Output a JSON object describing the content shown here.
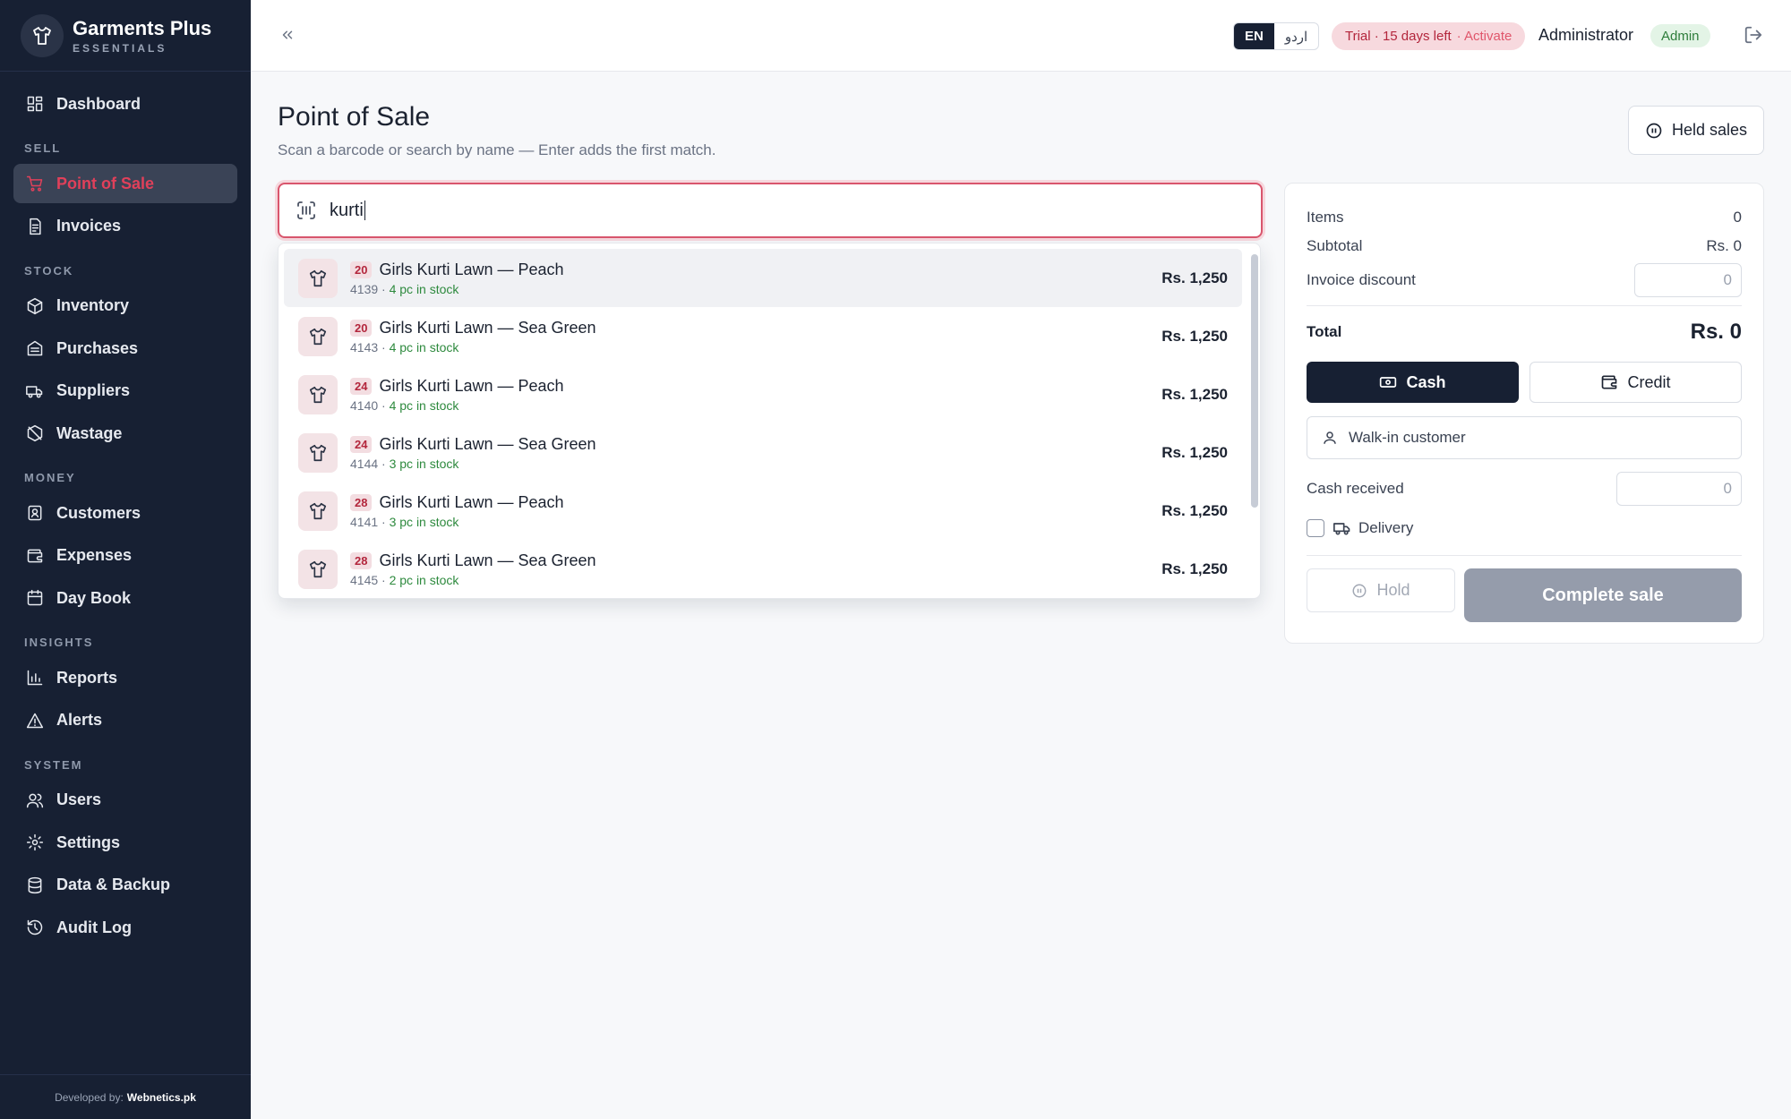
{
  "brand": {
    "name": "Garments Plus",
    "subtitle": "ESSENTIALS"
  },
  "sidebar": {
    "items": [
      {
        "label": "Dashboard",
        "icon": "dashboard-icon"
      },
      {
        "section": "SELL"
      },
      {
        "label": "Point of Sale",
        "icon": "cart-icon",
        "active": true
      },
      {
        "label": "Invoices",
        "icon": "invoice-icon"
      },
      {
        "section": "STOCK"
      },
      {
        "label": "Inventory",
        "icon": "package-icon"
      },
      {
        "label": "Purchases",
        "icon": "purchases-icon"
      },
      {
        "label": "Suppliers",
        "icon": "truck-icon"
      },
      {
        "label": "Wastage",
        "icon": "wastage-icon"
      },
      {
        "section": "MONEY"
      },
      {
        "label": "Customers",
        "icon": "contact-icon"
      },
      {
        "label": "Expenses",
        "icon": "wallet-icon"
      },
      {
        "label": "Day Book",
        "icon": "calendar-icon"
      },
      {
        "section": "INSIGHTS"
      },
      {
        "label": "Reports",
        "icon": "bar-chart-icon"
      },
      {
        "label": "Alerts",
        "icon": "alert-icon"
      },
      {
        "section": "SYSTEM"
      },
      {
        "label": "Users",
        "icon": "users-icon"
      },
      {
        "label": "Settings",
        "icon": "gear-icon"
      },
      {
        "label": "Data & Backup",
        "icon": "database-icon"
      },
      {
        "label": "Audit Log",
        "icon": "history-icon"
      }
    ],
    "footer_prefix": "Developed by:",
    "footer_brand": "Webnetics.pk"
  },
  "topbar": {
    "lang_en": "EN",
    "lang_ur": "اردو",
    "trial_text": "Trial · 15 days left",
    "trial_action": "· Activate",
    "user_name": "Administrator",
    "role": "Admin"
  },
  "page": {
    "title": "Point of Sale",
    "subtitle": "Scan a barcode or search by name — Enter adds the first match.",
    "held_sales_label": "Held sales"
  },
  "search": {
    "value": "kurti"
  },
  "results": [
    {
      "size": "20",
      "name": "Girls Kurti Lawn — Peach",
      "code": "4139 · ",
      "stock": "4 pc in stock",
      "price": "Rs. 1,250"
    },
    {
      "size": "20",
      "name": "Girls Kurti Lawn — Sea Green",
      "code": "4143 · ",
      "stock": "4 pc in stock",
      "price": "Rs. 1,250"
    },
    {
      "size": "24",
      "name": "Girls Kurti Lawn — Peach",
      "code": "4140 · ",
      "stock": "4 pc in stock",
      "price": "Rs. 1,250"
    },
    {
      "size": "24",
      "name": "Girls Kurti Lawn — Sea Green",
      "code": "4144 · ",
      "stock": "3 pc in stock",
      "price": "Rs. 1,250"
    },
    {
      "size": "28",
      "name": "Girls Kurti Lawn — Peach",
      "code": "4141 · ",
      "stock": "3 pc in stock",
      "price": "Rs. 1,250"
    },
    {
      "size": "28",
      "name": "Girls Kurti Lawn — Sea Green",
      "code": "4145 · ",
      "stock": "2 pc in stock",
      "price": "Rs. 1,250"
    }
  ],
  "cart": {
    "items_label": "Items",
    "items_value": "0",
    "subtotal_label": "Subtotal",
    "subtotal_value": "Rs. 0",
    "discount_label": "Invoice discount",
    "discount_value": "0",
    "total_label": "Total",
    "total_value": "Rs. 0",
    "cash_label": "Cash",
    "credit_label": "Credit",
    "customer_label": "Walk-in customer",
    "cash_received_label": "Cash received",
    "cash_received_value": "0",
    "delivery_label": "Delivery",
    "hold_label": "Hold",
    "complete_label": "Complete sale"
  },
  "colors": {
    "sidebar": "#172033",
    "accent": "#e0405a",
    "primary": "#172033"
  }
}
